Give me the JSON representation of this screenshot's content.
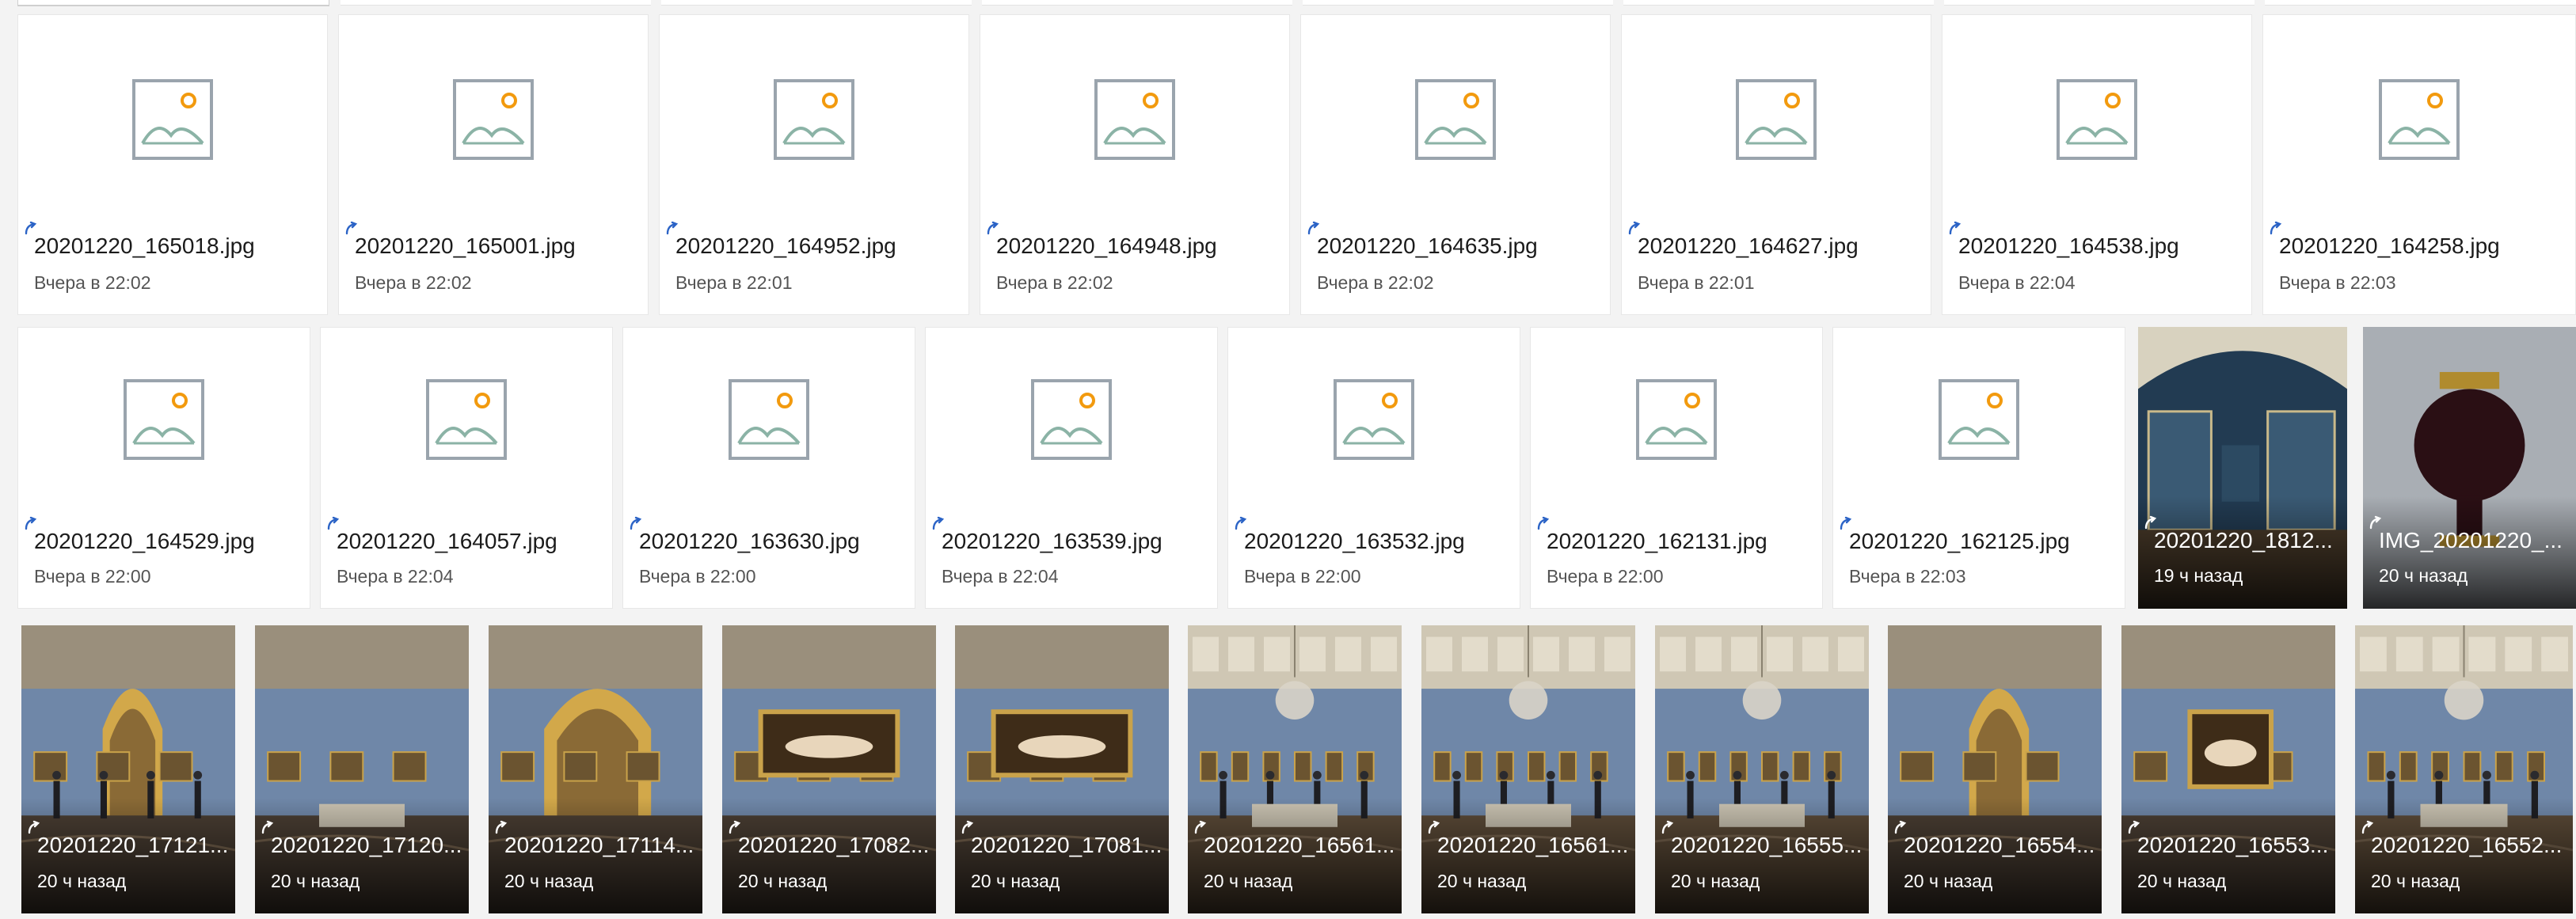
{
  "colors": {
    "background": "#f3f3f3",
    "tile": "#ffffff",
    "sync_icon": "#2b63c6",
    "image_icon_frame": "#9aa4ad",
    "image_icon_sun": "#f29a0e",
    "image_icon_hills": "#8bb3a6"
  },
  "icons": {
    "placeholder": "image-placeholder-icon",
    "sync": "sync-pending-icon"
  },
  "rows": [
    {
      "kind": "file",
      "items": [
        {
          "name": "20201220_165018.jpg",
          "time": "Вчера в 22:02"
        },
        {
          "name": "20201220_165001.jpg",
          "time": "Вчера в 22:02"
        },
        {
          "name": "20201220_164952.jpg",
          "time": "Вчера в 22:01"
        },
        {
          "name": "20201220_164948.jpg",
          "time": "Вчера в 22:02"
        },
        {
          "name": "20201220_164635.jpg",
          "time": "Вчера в 22:02"
        },
        {
          "name": "20201220_164627.jpg",
          "time": "Вчера в 22:01"
        },
        {
          "name": "20201220_164538.jpg",
          "time": "Вчера в 22:04"
        },
        {
          "name": "20201220_164258.jpg",
          "time": "Вчера в 22:03"
        }
      ]
    },
    {
      "kind": "mixed",
      "items": [
        {
          "type": "file",
          "name": "20201220_164529.jpg",
          "time": "Вчера в 22:00"
        },
        {
          "type": "file",
          "name": "20201220_164057.jpg",
          "time": "Вчера в 22:04"
        },
        {
          "type": "file",
          "name": "20201220_163630.jpg",
          "time": "Вчера в 22:00"
        },
        {
          "type": "file",
          "name": "20201220_163539.jpg",
          "time": "Вчера в 22:04"
        },
        {
          "type": "file",
          "name": "20201220_163532.jpg",
          "time": "Вчера в 22:00"
        },
        {
          "type": "file",
          "name": "20201220_162131.jpg",
          "time": "Вчера в 22:00"
        },
        {
          "type": "file",
          "name": "20201220_162125.jpg",
          "time": "Вчера в 22:03"
        },
        {
          "type": "photo",
          "scene": "hall-display-cases",
          "name": "20201220_1812...",
          "time": "19 ч назад"
        },
        {
          "type": "photo",
          "scene": "dark-urn",
          "name": "IMG_20201220_...",
          "time": "20 ч назад"
        }
      ]
    },
    {
      "kind": "photo",
      "items": [
        {
          "scene": "blue-gallery-arch",
          "name": "20201220_17121...",
          "time": "20 ч назад"
        },
        {
          "scene": "gallery-display-table",
          "name": "20201220_17120...",
          "time": "20 ч назад"
        },
        {
          "scene": "golden-arch-painting",
          "name": "20201220_17114...",
          "time": "20 ч назад"
        },
        {
          "scene": "reclining-nude-painting",
          "name": "20201220_17082...",
          "time": "20 ч назад"
        },
        {
          "scene": "reclining-nude-painting-wide",
          "name": "20201220_17081...",
          "time": "20 ч назад"
        },
        {
          "scene": "chandelier-hall",
          "name": "20201220_16561...",
          "time": "20 ч назад"
        },
        {
          "scene": "chandelier-hall",
          "name": "20201220_16561...",
          "time": "20 ч назад"
        },
        {
          "scene": "chandelier-hall-crowd",
          "name": "20201220_16555...",
          "time": "20 ч назад"
        },
        {
          "scene": "blue-gallery-arch-frames",
          "name": "20201220_16554...",
          "time": "20 ч назад"
        },
        {
          "scene": "portrait-blue-wall",
          "name": "20201220_16553...",
          "time": "20 ч назад"
        },
        {
          "scene": "chandelier-hall-wide",
          "name": "20201220_16552...",
          "time": "20 ч назад"
        }
      ]
    }
  ]
}
